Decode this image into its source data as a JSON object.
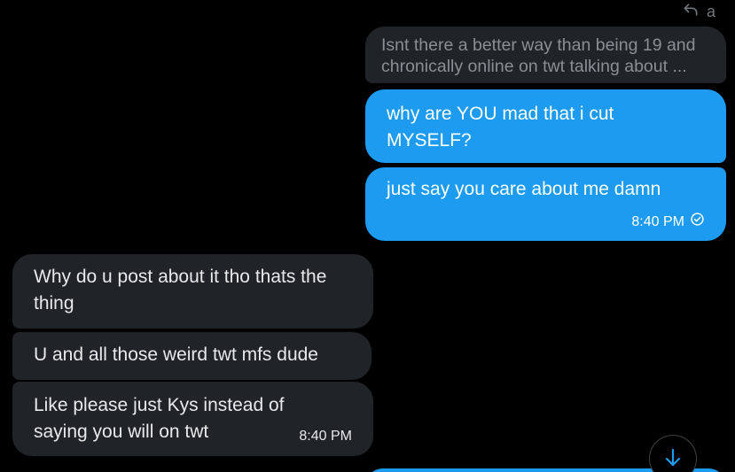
{
  "reply_hint": {
    "icon": "reply-icon",
    "label": "a"
  },
  "quoted_message": {
    "line1": "Isnt there a better way than being 19 and",
    "line2": "chronically online on twt talking about ..."
  },
  "outgoing": [
    {
      "text": "why are YOU mad that i cut MYSELF?"
    },
    {
      "text": "just say you care about me damn",
      "time": "8:40 PM",
      "status_icon": "sent-check-icon"
    }
  ],
  "incoming": [
    {
      "text": "Why do u post about it tho thats the thing"
    },
    {
      "text": "U and all those weird twt mfs dude"
    },
    {
      "text": "Like please just Kys instead of saying you will on twt",
      "time": "8:40 PM"
    }
  ],
  "scroll_button": {
    "icon": "arrow-down-icon"
  },
  "colors": {
    "background": "#000000",
    "outgoing_bubble": "#1d9bf0",
    "incoming_bubble": "#202327",
    "text_primary": "#e7e9ea",
    "text_muted": "#71767b"
  }
}
